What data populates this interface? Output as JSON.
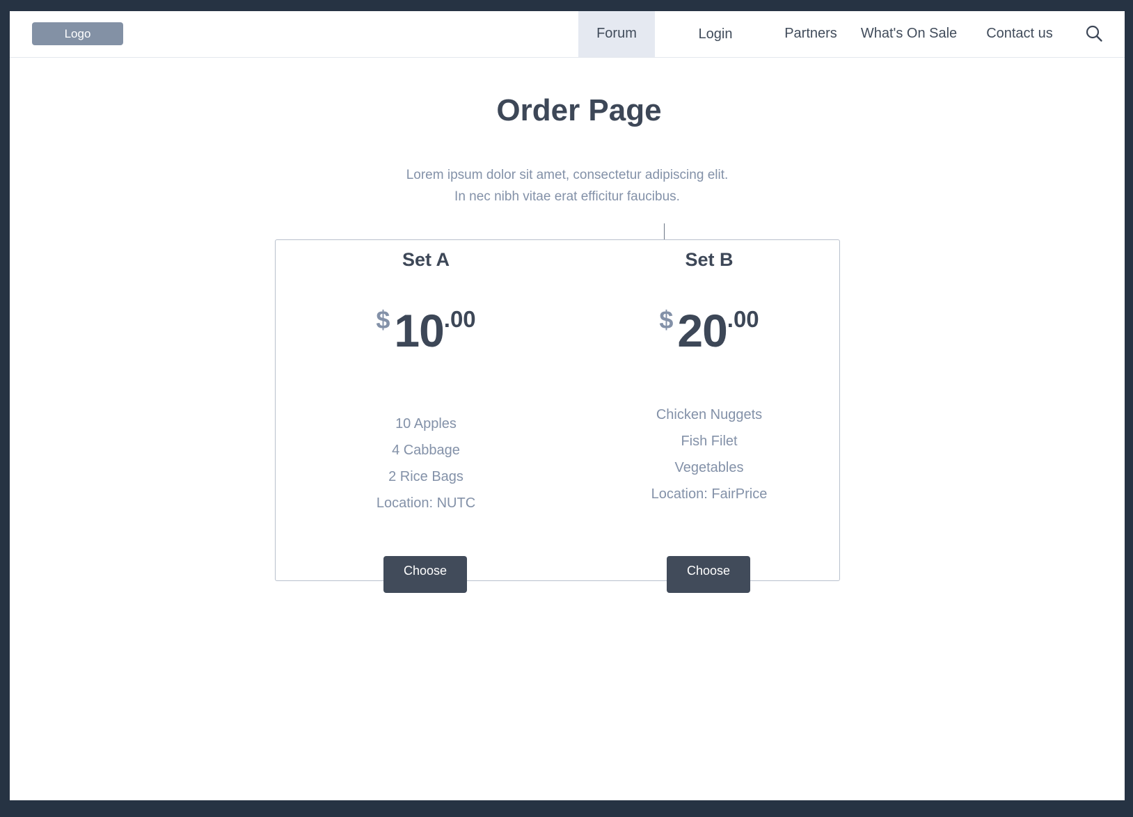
{
  "header": {
    "logo_label": "Logo",
    "nav": {
      "forum": "Forum",
      "login": "Login",
      "partners": "Partners",
      "sale": "What's On Sale",
      "contact": "Contact us"
    },
    "active_nav": "Forum",
    "search_icon": "search-icon"
  },
  "main": {
    "title": "Order Page",
    "subtitle_line1": "Lorem ipsum dolor sit amet, consectetur adipiscing elit.",
    "subtitle_line2": "In nec nibh vitae erat efficitur faucibus."
  },
  "plans": [
    {
      "name": "Set A",
      "currency": "$",
      "price_whole": "10",
      "price_cents": ".00",
      "items": [
        "10 Apples",
        "4 Cabbage",
        "2 Rice Bags",
        "Location: NUTC"
      ],
      "button_label": "Choose"
    },
    {
      "name": "Set B",
      "currency": "$",
      "price_whole": "20",
      "price_cents": ".00",
      "items": [
        "Chicken Nuggets",
        "Fish Filet",
        "Vegetables",
        "Location: FairPrice"
      ],
      "button_label": "Choose"
    }
  ],
  "colors": {
    "background": "#263343",
    "primary_text": "#3d4757",
    "muted_text": "#8391a8",
    "button": "#414b5a",
    "logo_button": "#8391a5",
    "active_nav_bg": "#e5e9f1"
  }
}
